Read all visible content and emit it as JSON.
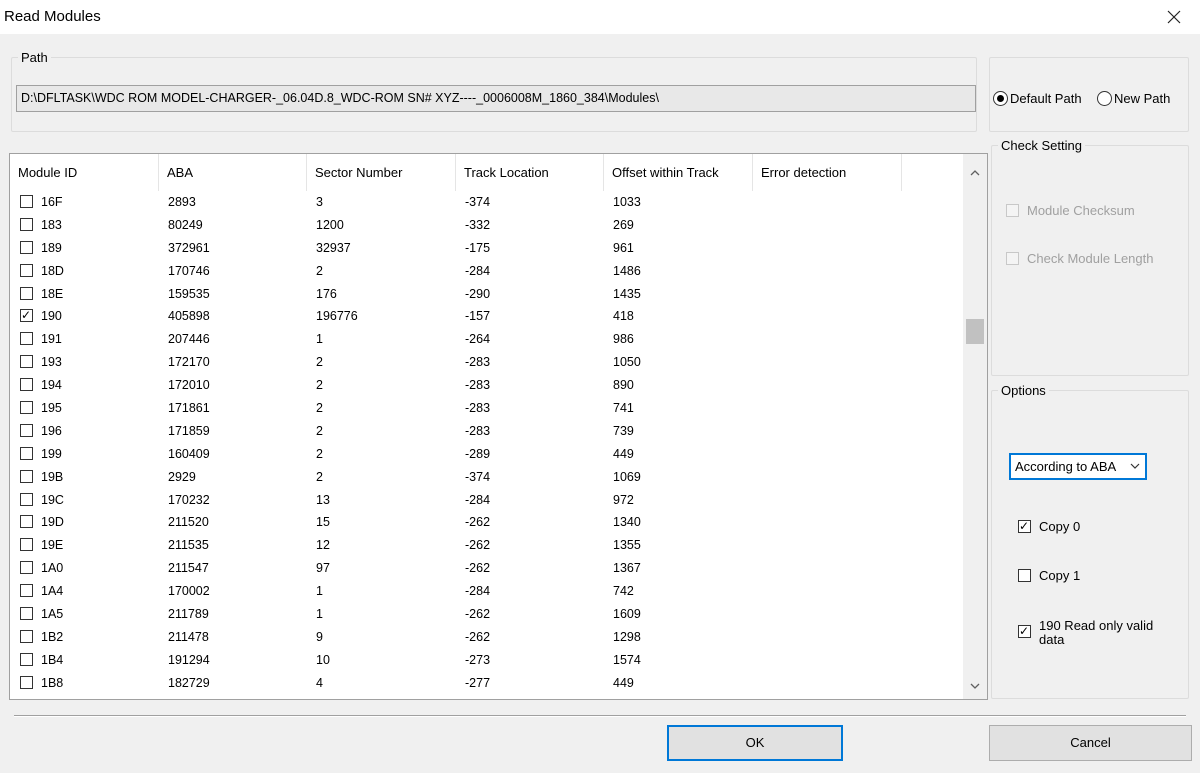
{
  "window": {
    "title": "Read Modules"
  },
  "path_group": {
    "legend": "Path",
    "value": "D:\\DFLTASK\\WDC ROM MODEL-CHARGER-_06.04D.8_WDC-ROM SN# XYZ----_0006008M_1860_384\\Modules\\",
    "default_path_label": "Default Path",
    "new_path_label": "New Path",
    "selected": "default"
  },
  "table": {
    "columns": [
      "Module ID",
      "ABA",
      "Sector Number",
      "Track Location",
      "Offset within Track",
      "Error detection"
    ],
    "rows": [
      {
        "checked": false,
        "id": "16F",
        "aba": "2893",
        "sector": "3",
        "track": "-374",
        "offset": "1033",
        "error": ""
      },
      {
        "checked": false,
        "id": "183",
        "aba": "80249",
        "sector": "1200",
        "track": "-332",
        "offset": "269",
        "error": ""
      },
      {
        "checked": false,
        "id": "189",
        "aba": "372961",
        "sector": "32937",
        "track": "-175",
        "offset": "961",
        "error": ""
      },
      {
        "checked": false,
        "id": "18D",
        "aba": "170746",
        "sector": "2",
        "track": "-284",
        "offset": "1486",
        "error": ""
      },
      {
        "checked": false,
        "id": "18E",
        "aba": "159535",
        "sector": "176",
        "track": "-290",
        "offset": "1435",
        "error": ""
      },
      {
        "checked": true,
        "id": "190",
        "aba": "405898",
        "sector": "196776",
        "track": "-157",
        "offset": "418",
        "error": ""
      },
      {
        "checked": false,
        "id": "191",
        "aba": "207446",
        "sector": "1",
        "track": "-264",
        "offset": "986",
        "error": ""
      },
      {
        "checked": false,
        "id": "193",
        "aba": "172170",
        "sector": "2",
        "track": "-283",
        "offset": "1050",
        "error": ""
      },
      {
        "checked": false,
        "id": "194",
        "aba": "172010",
        "sector": "2",
        "track": "-283",
        "offset": "890",
        "error": ""
      },
      {
        "checked": false,
        "id": "195",
        "aba": "171861",
        "sector": "2",
        "track": "-283",
        "offset": "741",
        "error": ""
      },
      {
        "checked": false,
        "id": "196",
        "aba": "171859",
        "sector": "2",
        "track": "-283",
        "offset": "739",
        "error": ""
      },
      {
        "checked": false,
        "id": "199",
        "aba": "160409",
        "sector": "2",
        "track": "-289",
        "offset": "449",
        "error": ""
      },
      {
        "checked": false,
        "id": "19B",
        "aba": "2929",
        "sector": "2",
        "track": "-374",
        "offset": "1069",
        "error": ""
      },
      {
        "checked": false,
        "id": "19C",
        "aba": "170232",
        "sector": "13",
        "track": "-284",
        "offset": "972",
        "error": ""
      },
      {
        "checked": false,
        "id": "19D",
        "aba": "211520",
        "sector": "15",
        "track": "-262",
        "offset": "1340",
        "error": ""
      },
      {
        "checked": false,
        "id": "19E",
        "aba": "211535",
        "sector": "12",
        "track": "-262",
        "offset": "1355",
        "error": ""
      },
      {
        "checked": false,
        "id": "1A0",
        "aba": "211547",
        "sector": "97",
        "track": "-262",
        "offset": "1367",
        "error": ""
      },
      {
        "checked": false,
        "id": "1A4",
        "aba": "170002",
        "sector": "1",
        "track": "-284",
        "offset": "742",
        "error": ""
      },
      {
        "checked": false,
        "id": "1A5",
        "aba": "211789",
        "sector": "1",
        "track": "-262",
        "offset": "1609",
        "error": ""
      },
      {
        "checked": false,
        "id": "1B2",
        "aba": "211478",
        "sector": "9",
        "track": "-262",
        "offset": "1298",
        "error": ""
      },
      {
        "checked": false,
        "id": "1B4",
        "aba": "191294",
        "sector": "10",
        "track": "-273",
        "offset": "1574",
        "error": ""
      },
      {
        "checked": false,
        "id": "1B8",
        "aba": "182729",
        "sector": "4",
        "track": "-277",
        "offset": "449",
        "error": ""
      }
    ],
    "scroll_position": 0.29,
    "visible_fraction": 0.05
  },
  "check_setting": {
    "legend": "Check Setting",
    "module_checksum": {
      "label": "Module Checksum",
      "checked": false,
      "enabled": false
    },
    "check_module_length": {
      "label": "Check Module Length",
      "checked": false,
      "enabled": false
    }
  },
  "options": {
    "legend": "Options",
    "sort_select": "According to ABA",
    "copy0": {
      "label": "Copy 0",
      "checked": true
    },
    "copy1": {
      "label": "Copy 1",
      "checked": false
    },
    "read_valid": {
      "label": "190 Read only valid data",
      "checked": true
    }
  },
  "buttons": {
    "ok": "OK",
    "cancel": "Cancel"
  },
  "colors": {
    "accent": "#0078d7",
    "window_bg": "#f0f0f0"
  }
}
